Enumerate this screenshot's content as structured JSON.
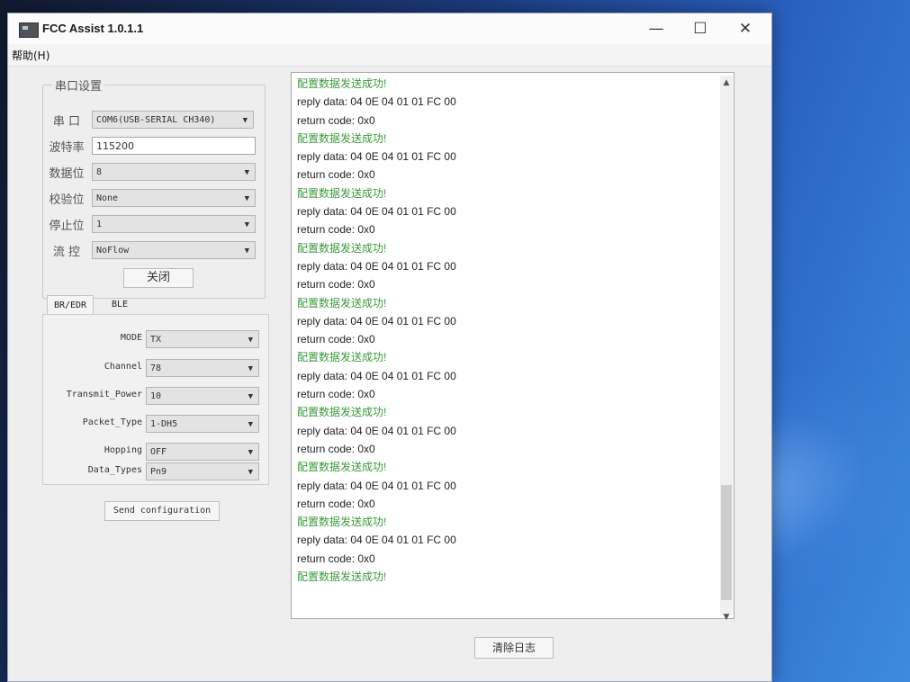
{
  "window": {
    "title": "FCC Assist 1.0.1.1",
    "minimize": "—",
    "maximize": "☐",
    "close": "✕"
  },
  "menu": {
    "help": "帮助(H)"
  },
  "serial": {
    "group_title": "串口设置",
    "port_label": "串 口",
    "port_value": "COM6(USB-SERIAL CH340)",
    "baud_label": "波特率",
    "baud_value": "115200",
    "databits_label": "数据位",
    "databits_value": "8",
    "parity_label": "校验位",
    "parity_value": "None",
    "stopbits_label": "停止位",
    "stopbits_value": "1",
    "flow_label": "流 控",
    "flow_value": "NoFlow",
    "close_button": "关闭"
  },
  "tabs": {
    "items": [
      "BR/EDR",
      "BLE"
    ]
  },
  "params": [
    {
      "label": "MODE",
      "value": "TX"
    },
    {
      "label": "Channel",
      "value": "78"
    },
    {
      "label": "Transmit_Power",
      "value": "10"
    },
    {
      "label": "Packet_Type",
      "value": "1-DH5"
    },
    {
      "label": "Hopping",
      "value": "OFF"
    },
    {
      "label": "Data_Types",
      "value": "Pn9"
    }
  ],
  "send_button": "Send configuration",
  "clear_button": "清除日志",
  "log": [
    {
      "text": "配置数据发送成功!",
      "color": "#3a9a3a"
    },
    {
      "text": "reply data: 04 0E 04 01 01 FC 00",
      "color": "#222222"
    },
    {
      "text": "return code: 0x0",
      "color": "#222222"
    },
    {
      "text": "配置数据发送成功!",
      "color": "#3a9a3a"
    },
    {
      "text": "reply data: 04 0E 04 01 01 FC 00",
      "color": "#222222"
    },
    {
      "text": "return code: 0x0",
      "color": "#222222"
    },
    {
      "text": "配置数据发送成功!",
      "color": "#3a9a3a"
    },
    {
      "text": "reply data: 04 0E 04 01 01 FC 00",
      "color": "#222222"
    },
    {
      "text": "return code: 0x0",
      "color": "#222222"
    },
    {
      "text": "配置数据发送成功!",
      "color": "#3a9a3a"
    },
    {
      "text": "reply data: 04 0E 04 01 01 FC 00",
      "color": "#222222"
    },
    {
      "text": "return code: 0x0",
      "color": "#222222"
    },
    {
      "text": "配置数据发送成功!",
      "color": "#3a9a3a"
    },
    {
      "text": "reply data: 04 0E 04 01 01 FC 00",
      "color": "#222222"
    },
    {
      "text": "return code: 0x0",
      "color": "#222222"
    },
    {
      "text": "配置数据发送成功!",
      "color": "#3a9a3a"
    },
    {
      "text": "reply data: 04 0E 04 01 01 FC 00",
      "color": "#222222"
    },
    {
      "text": "return code: 0x0",
      "color": "#222222"
    },
    {
      "text": "配置数据发送成功!",
      "color": "#3a9a3a"
    },
    {
      "text": "reply data: 04 0E 04 01 01 FC 00",
      "color": "#222222"
    },
    {
      "text": "return code: 0x0",
      "color": "#222222"
    },
    {
      "text": "配置数据发送成功!",
      "color": "#3a9a3a"
    },
    {
      "text": "reply data: 04 0E 04 01 01 FC 00",
      "color": "#222222"
    },
    {
      "text": "return code: 0x0",
      "color": "#222222"
    },
    {
      "text": "配置数据发送成功!",
      "color": "#3a9a3a"
    },
    {
      "text": "reply data: 04 0E 04 01 01 FC 00",
      "color": "#222222"
    },
    {
      "text": "return code: 0x0",
      "color": "#222222"
    },
    {
      "text": "配置数据发送成功!",
      "color": "#3a9a3a"
    }
  ],
  "icons": {
    "scroll_up": "▲",
    "scroll_down": "▼",
    "dropdown": "▼"
  }
}
